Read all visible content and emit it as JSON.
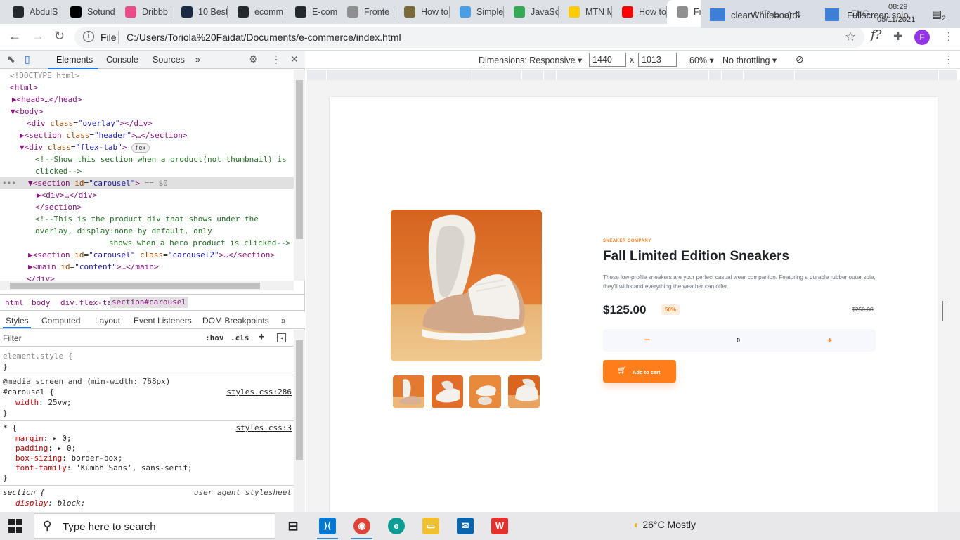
{
  "browser": {
    "tabs": [
      {
        "title": "AbdulS",
        "icon": "github-icon",
        "color": "#24292e"
      },
      {
        "title": "Sotund",
        "icon": "sotund-icon",
        "color": "#000000"
      },
      {
        "title": "Dribbb",
        "icon": "dribbble-icon",
        "color": "#ea4c89"
      },
      {
        "title": "10 Best",
        "icon": "h-icon",
        "color": "#1a2a44"
      },
      {
        "title": "ecomm",
        "icon": "github-icon",
        "color": "#24292e"
      },
      {
        "title": "E-com",
        "icon": "github-icon",
        "color": "#24292e"
      },
      {
        "title": "Fronte",
        "icon": "frontend-mentor-icon",
        "color": "#8f8f8f"
      },
      {
        "title": "How to",
        "icon": "stack-exchange-icon",
        "color": "#7a6a3a"
      },
      {
        "title": "Simple",
        "icon": "cloud-icon",
        "color": "#4a9ee6"
      },
      {
        "title": "JavaSc",
        "icon": "google-drive-icon",
        "color": "#34a853"
      },
      {
        "title": "MTN M",
        "icon": "mtn-icon",
        "color": "#ffcb05"
      },
      {
        "title": "How to",
        "icon": "youtube-icon",
        "color": "#ff0000"
      },
      {
        "title": "Fro",
        "icon": "frontend-mentor-icon",
        "color": "#8f8f8f",
        "active": true
      },
      {
        "title": "e-comr",
        "icon": "github-icon",
        "color": "#24292e"
      }
    ],
    "new_tab": "+",
    "window_controls": [
      "—",
      "❐",
      "✕"
    ],
    "address": {
      "scheme": "File",
      "url": "C:/Users/Toriola%20Faidat/Documents/e-commerce/index.html"
    },
    "profile_initial": "F",
    "formula_label": "f?"
  },
  "devtools": {
    "tabs": [
      "Elements",
      "Console",
      "Sources",
      "»"
    ],
    "dom": [
      "<!DOCTYPE html>",
      "<html>",
      "<head>…</head>",
      "<body>",
      "<div class=\"overlay\"></div>",
      "<section class=\"header\">…</section>",
      "<div class=\"flex-tab\">",
      "flex",
      "<!--Show this section when a product(not thumbnail) is",
      "clicked-->",
      "<section id=\"carousel\">",
      "== $0",
      "<div>…</div>",
      "</section>",
      "<!--This is the product div that shows under the",
      "overlay, display:none by default, only",
      "shows when a hero product is clicked-->",
      "<section id=\"carousel\" class=\"carousel2\">…</section>",
      "<main id=\"content\">…</main>",
      "</div>"
    ],
    "breadcrumbs": [
      "html",
      "body",
      "div.flex-tab",
      "section#carousel"
    ],
    "style_tabs": [
      "Styles",
      "Computed",
      "Layout",
      "Event Listeners",
      "DOM Breakpoints",
      "»"
    ],
    "filter_placeholder": "Filter",
    "filter_buttons": [
      ":hov",
      ".cls",
      "+"
    ],
    "styles": {
      "element_style": "element.style {",
      "close": "}",
      "media": "@media screen and (min-width: 768px)",
      "carousel_selector": "#carousel {",
      "carousel_source": "styles.css:286",
      "carousel_prop": "width",
      "carousel_val": "25vw;",
      "universal_selector": "* {",
      "universal_source": "styles.css:3",
      "universal_props": [
        {
          "prop": "margin",
          "val": "0;"
        },
        {
          "prop": "padding",
          "val": "0;"
        },
        {
          "prop": "box-sizing",
          "val": "border-box;"
        },
        {
          "prop": "font-family",
          "val": "'Kumbh Sans', sans-serif;"
        }
      ],
      "section_selector": "section {",
      "section_source": "user agent stylesheet",
      "section_prop": "display",
      "section_val": "block;"
    }
  },
  "device_toolbar": {
    "dimensions_label": "Dimensions: Responsive",
    "width": "1440",
    "height": "1013",
    "times": "x",
    "zoom": "60%",
    "throttle": "No throttling"
  },
  "product": {
    "company": "SNEAKER COMPANY",
    "title": "Fall Limited Edition Sneakers",
    "description": "These low-profile sneakers are your perfect casual wear companion. Featuring a durable rubber outer sole, they'll withstand everything the weather can offer.",
    "price": "$125.00",
    "discount": "50%",
    "old_price": "$250.00",
    "quantity": "0",
    "minus": "−",
    "plus": "+",
    "add_to_cart": "Add to cart",
    "accent": "#ff7d1a"
  },
  "taskbar": {
    "search_placeholder": "Type here to search",
    "weather": "26°C  Mostly",
    "tray_label_1": "clearWhiteboard",
    "tray_label_2": "Fullscreen snip",
    "language": "ENG",
    "time": "08:29",
    "date": "05/11/2021",
    "notification_count": "2"
  }
}
